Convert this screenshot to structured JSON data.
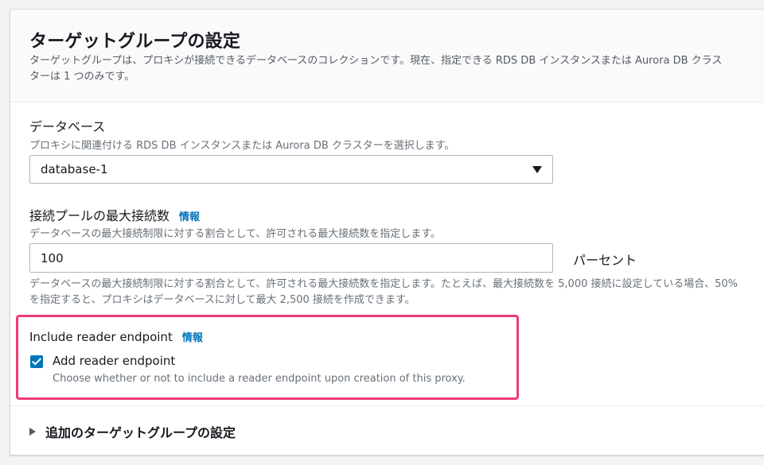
{
  "panel": {
    "title": "ターゲットグループの設定",
    "description": "ターゲットグループは、プロキシが接続できるデータベースのコレクションです。現在、指定できる RDS DB インスタンスまたは Aurora DB クラスターは 1 つのみです。"
  },
  "database": {
    "label": "データベース",
    "description": "プロキシに関連付ける RDS DB インスタンスまたは Aurora DB クラスターを選択します。",
    "selected": "database-1"
  },
  "max_connections": {
    "label": "接続プールの最大接続数",
    "info": "情報",
    "description": "データベースの最大接続制限に対する割合として、許可される最大接続数を指定します。",
    "value": "100",
    "suffix": "パーセント",
    "constraint": "データベースの最大接続制限に対する割合として、許可される最大接続数を指定します。たとえば、最大接続数を 5,000 接続に設定している場合、50% を指定すると、プロキシはデータベースに対して最大 2,500 接続を作成できます。"
  },
  "reader_endpoint": {
    "label": "Include reader endpoint",
    "info": "情報",
    "checkbox_label": "Add reader endpoint",
    "checkbox_desc": "Choose whether or not to include a reader endpoint upon creation of this proxy.",
    "checked": true
  },
  "additional": {
    "label": "追加のターゲットグループの設定"
  },
  "colors": {
    "accent": "#0073bb",
    "highlight": "#ee3c78"
  }
}
